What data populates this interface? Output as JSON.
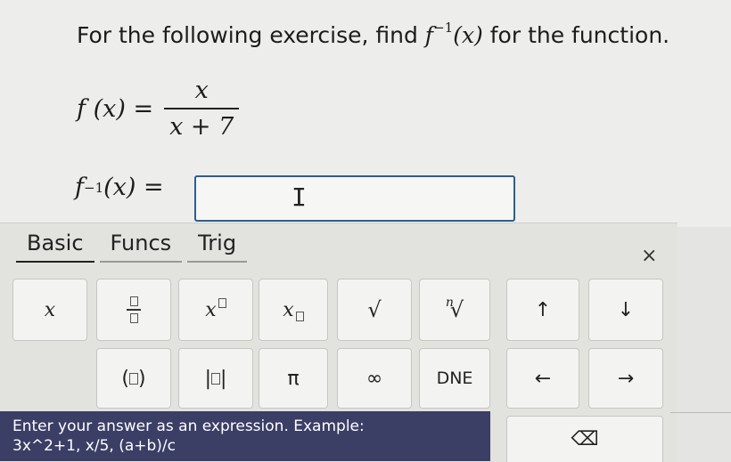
{
  "question": {
    "prefix": "For the following exercise, find ",
    "func_name": "f",
    "sup": "−1",
    "arg": "(x)",
    "suffix": " for the function."
  },
  "function_def": {
    "lhs": "f (x) =",
    "numerator": "x",
    "denominator": "x + 7"
  },
  "answer": {
    "label_f": "f",
    "label_sup": "−1",
    "label_rest": "(x) =",
    "value": "",
    "cursor_glyph": "I"
  },
  "keypad": {
    "tabs": [
      {
        "label": "Basic",
        "active": true
      },
      {
        "label": "Funcs",
        "active": false
      },
      {
        "label": "Trig",
        "active": false
      }
    ],
    "close_label": "×",
    "row1": {
      "x": "x",
      "power_base": "x",
      "subscript_base": "x",
      "sqrt": "√",
      "nth_index": "n",
      "nth_root": "√",
      "up": "↑",
      "down": "↓"
    },
    "row2": {
      "paren_open": "(",
      "paren_close": ")",
      "abs_open": "|",
      "abs_close": "|",
      "pi": "π",
      "infinity": "∞",
      "dne": "DNE",
      "left": "←",
      "right": "→"
    },
    "backspace": "⌫"
  },
  "help": {
    "line1": "Enter your answer as an expression. Example:",
    "line2": "3x^2+1, x/5, (a+b)/c"
  }
}
